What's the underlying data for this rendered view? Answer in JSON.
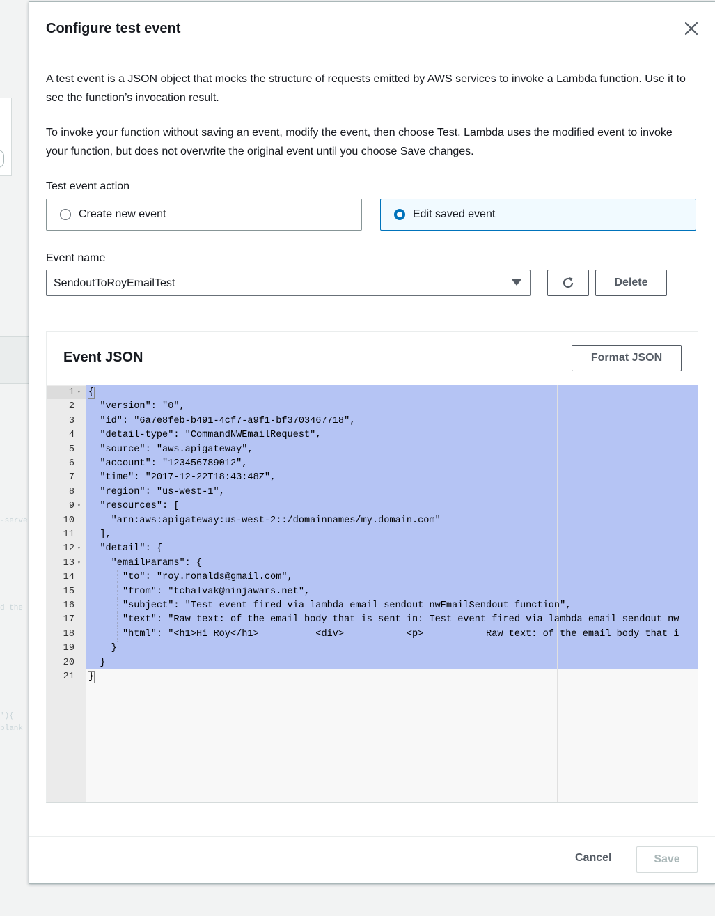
{
  "background": {
    "code_fragments": [
      "-servel",
      "d the",
      "'){",
      "blank"
    ]
  },
  "modal": {
    "title": "Configure test event",
    "description_1": "A test event is a JSON object that mocks the structure of requests emitted by AWS services to invoke a Lambda function. Use it to see the function’s invocation result.",
    "description_2": "To invoke your function without saving an event, modify the event, then choose Test. Lambda uses the modified event to invoke your function, but does not overwrite the original event until you choose Save changes.",
    "test_event_action": {
      "label": "Test event action",
      "options": [
        {
          "label": "Create new event",
          "selected": false
        },
        {
          "label": "Edit saved event",
          "selected": true
        }
      ]
    },
    "event_name": {
      "label": "Event name",
      "value": "SendoutToRoyEmailTest"
    },
    "delete_label": "Delete",
    "event_json": {
      "title": "Event JSON",
      "format_label": "Format JSON",
      "lines": [
        {
          "n": "1",
          "fold": true,
          "text": "{"
        },
        {
          "n": "2",
          "fold": false,
          "text": "  \"version\": \"0\","
        },
        {
          "n": "3",
          "fold": false,
          "text": "  \"id\": \"6a7e8feb-b491-4cf7-a9f1-bf3703467718\","
        },
        {
          "n": "4",
          "fold": false,
          "text": "  \"detail-type\": \"CommandNWEmailRequest\","
        },
        {
          "n": "5",
          "fold": false,
          "text": "  \"source\": \"aws.apigateway\","
        },
        {
          "n": "6",
          "fold": false,
          "text": "  \"account\": \"123456789012\","
        },
        {
          "n": "7",
          "fold": false,
          "text": "  \"time\": \"2017-12-22T18:43:48Z\","
        },
        {
          "n": "8",
          "fold": false,
          "text": "  \"region\": \"us-west-1\","
        },
        {
          "n": "9",
          "fold": true,
          "text": "  \"resources\": ["
        },
        {
          "n": "10",
          "fold": false,
          "text": "    \"arn:aws:apigateway:us-west-2::/domainnames/my.domain.com\""
        },
        {
          "n": "11",
          "fold": false,
          "text": "  ],"
        },
        {
          "n": "12",
          "fold": true,
          "text": "  \"detail\": {"
        },
        {
          "n": "13",
          "fold": true,
          "text": "    \"emailParams\": {"
        },
        {
          "n": "14",
          "fold": false,
          "text": "      \"to\": \"roy.ronalds@gmail.com\","
        },
        {
          "n": "15",
          "fold": false,
          "text": "      \"from\": \"tchalvak@ninjawars.net\","
        },
        {
          "n": "16",
          "fold": false,
          "text": "      \"subject\": \"Test event fired via lambda email sendout nwEmailSendout function\","
        },
        {
          "n": "17",
          "fold": false,
          "text": "      \"text\": \"Raw text: of the email body that is sent in: Test event fired via lambda email sendout nw"
        },
        {
          "n": "18",
          "fold": false,
          "text": "      \"html\": \"<h1>Hi Roy</h1>          <div>           <p>           Raw text: of the email body that i"
        },
        {
          "n": "19",
          "fold": false,
          "text": "    }"
        },
        {
          "n": "20",
          "fold": false,
          "text": "  }"
        },
        {
          "n": "21",
          "fold": false,
          "text": "}"
        }
      ]
    },
    "footer": {
      "cancel_label": "Cancel",
      "save_label": "Save"
    }
  }
}
